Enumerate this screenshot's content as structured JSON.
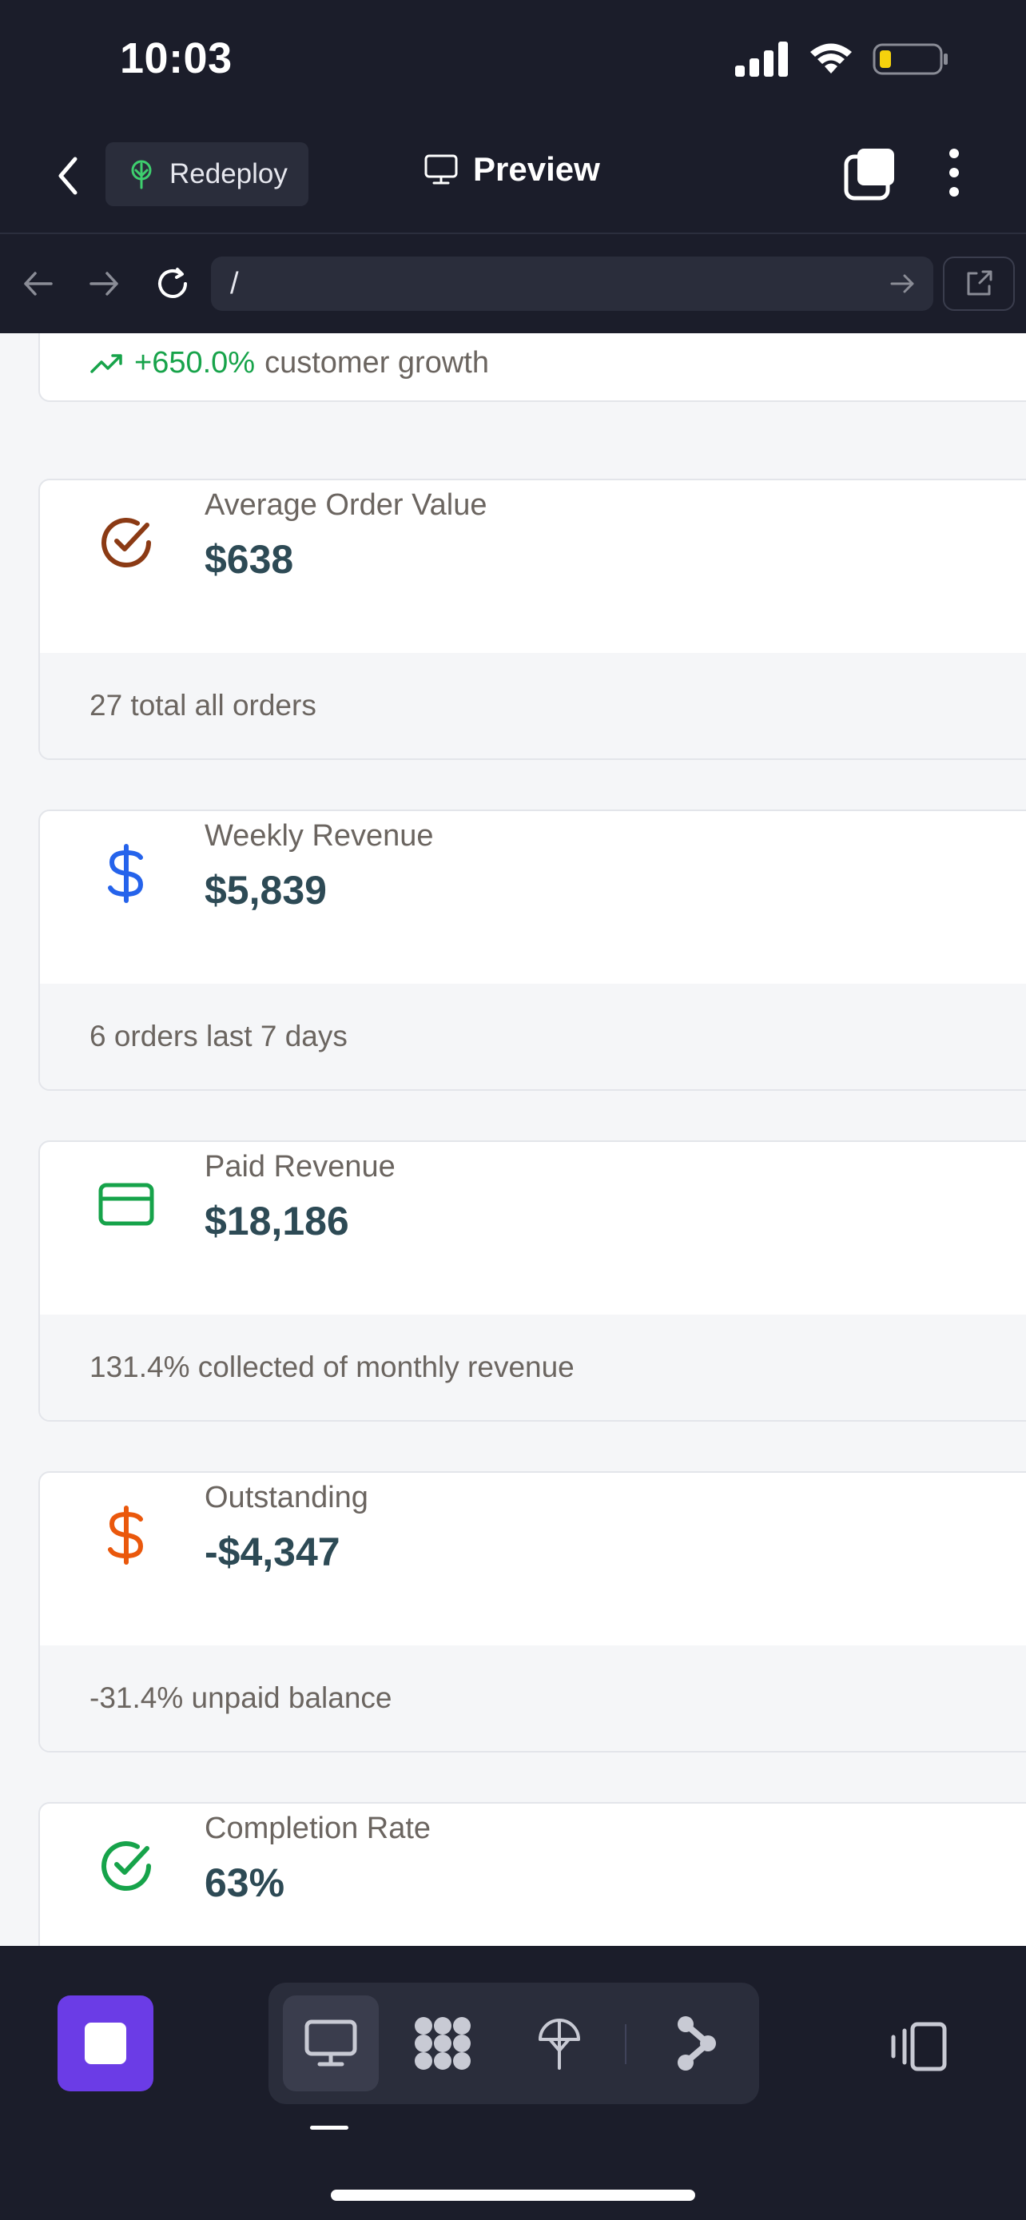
{
  "status_bar": {
    "time": "10:03"
  },
  "header": {
    "redeploy_label": "Redeploy",
    "preview_label": "Preview"
  },
  "browser": {
    "url": "/"
  },
  "growth": {
    "value": "+650.0%",
    "text": "customer growth",
    "color": "#17a34a"
  },
  "cards": [
    {
      "label": "Average Order Value",
      "value": "$638",
      "footer": "27 total all orders",
      "icon": "check-circle-icon",
      "icon_color": "#8b3a14"
    },
    {
      "label": "Weekly Revenue",
      "value": "$5,839",
      "footer": "6 orders last 7 days",
      "icon": "dollar-icon",
      "icon_color": "#2563eb"
    },
    {
      "label": "Paid Revenue",
      "value": "$18,186",
      "footer": "131.4% collected of monthly revenue",
      "icon": "credit-card-icon",
      "icon_color": "#16a34a"
    },
    {
      "label": "Outstanding",
      "value": "-$4,347",
      "footer": "-31.4% unpaid balance",
      "icon": "dollar-icon",
      "icon_color": "#ea580c"
    },
    {
      "label": "Completion Rate",
      "value": "63%",
      "footer": "",
      "icon": "check-circle-icon",
      "icon_color": "#16a34a"
    }
  ],
  "bottom_bar": {
    "tools": [
      "desktop-icon",
      "grid-icon",
      "deploy-icon",
      "git-icon"
    ],
    "stop_color": "#6b3ce6"
  }
}
